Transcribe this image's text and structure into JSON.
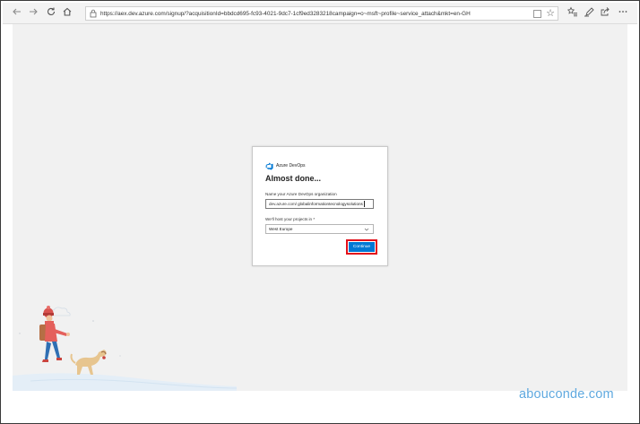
{
  "browser": {
    "url": "https://aex.dev.azure.com/signup/?acquisitionId=bbdcd695-fc93-4021-9dc7-1cf9ed3283218campaign=o~msft~profile~service_attach&mkt=en-GH",
    "icons": [
      "back-icon",
      "forward-icon",
      "refresh-icon",
      "home-icon",
      "lock-icon",
      "reading-view-icon",
      "star-icon",
      "favorites-icon",
      "pen-icon",
      "share-icon",
      "more-icon"
    ]
  },
  "dialog": {
    "brand": "Azure DevOps",
    "heading": "Almost done...",
    "org_label": "Name your Azure DevOps organization",
    "org_prefix": "dev.azure.com/",
    "org_value": "globalinformationtecnologysolutions",
    "region_label": "We'll host your projects in *",
    "region_value": "West Europe",
    "continue_label": "Continue"
  },
  "colors": {
    "accent": "#0078d4",
    "highlight": "#e3101a",
    "watermark": "#5fa9df"
  },
  "watermark": "abouconde.com"
}
